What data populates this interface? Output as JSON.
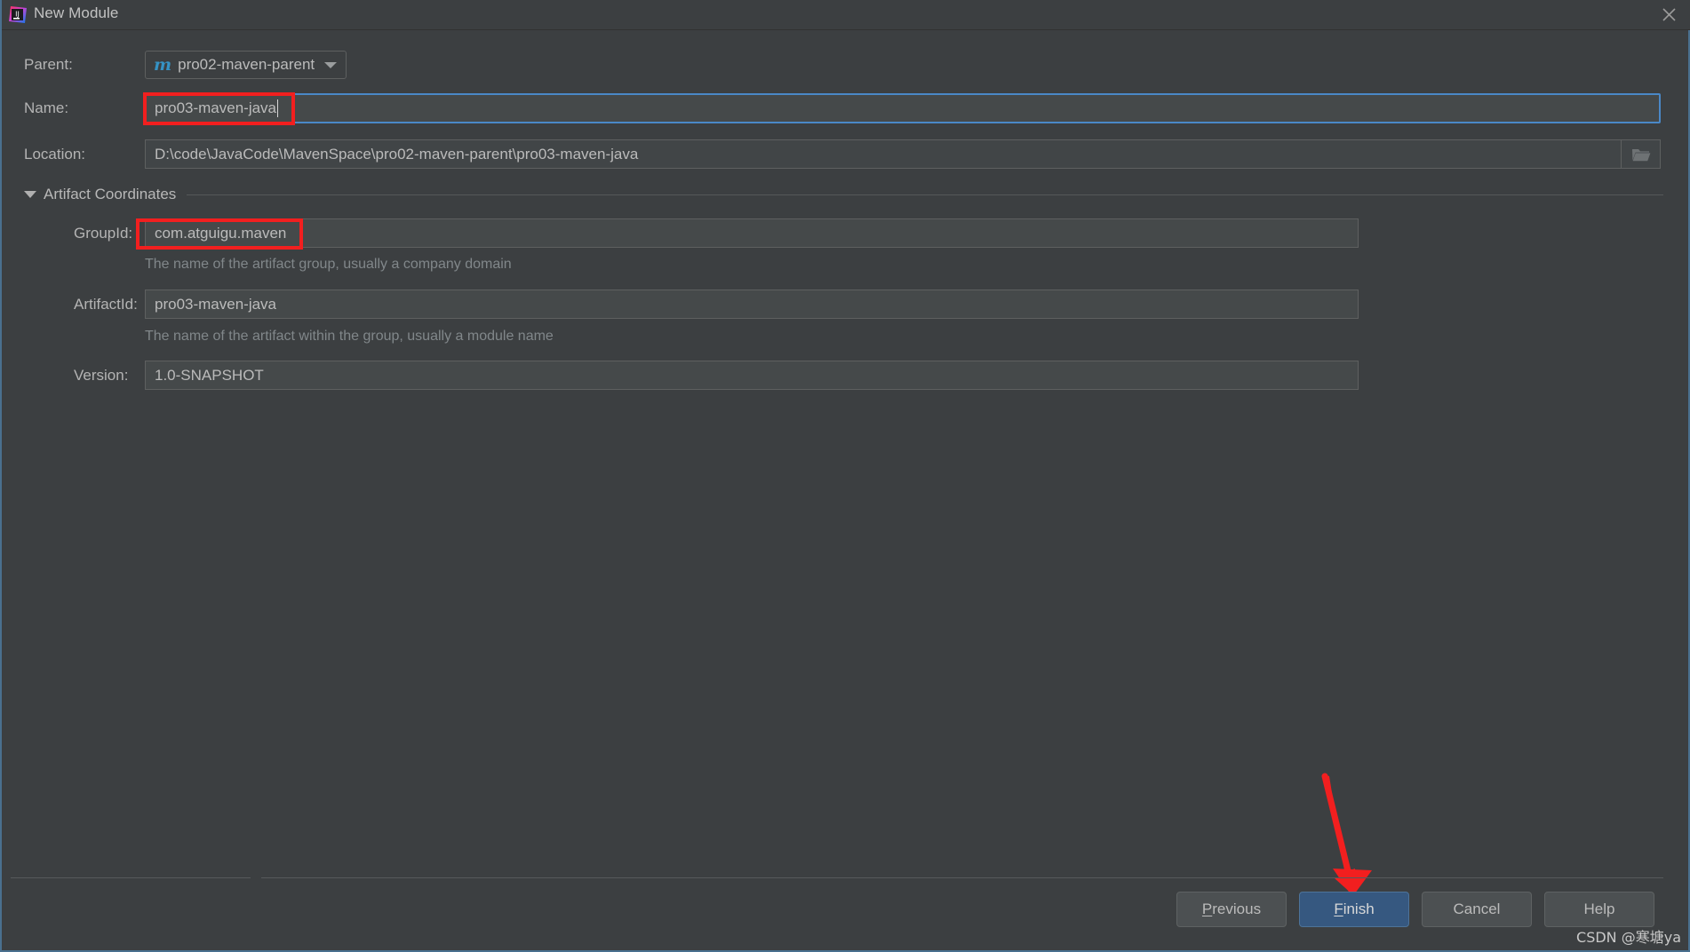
{
  "window": {
    "title": "New Module",
    "app_icon": "intellij-idea-icon",
    "close_icon": "close-icon"
  },
  "form": {
    "parent": {
      "label": "Parent:",
      "value": "pro02-maven-parent",
      "icon": "maven-icon",
      "dropdown_icon": "chevron-down-icon"
    },
    "name": {
      "label": "Name:",
      "value": "pro03-maven-java",
      "focused": true
    },
    "location": {
      "label": "Location:",
      "value": "D:\\code\\JavaCode\\MavenSpace\\pro02-maven-parent\\pro03-maven-java",
      "browse_icon": "folder-icon"
    }
  },
  "artifact_coordinates": {
    "section_label": "Artifact Coordinates",
    "expanded": true,
    "collapse_icon": "triangle-down-icon",
    "group_id": {
      "label": "GroupId:",
      "value": "com.atguigu.maven",
      "hint": "The name of the artifact group, usually a company domain"
    },
    "artifact_id": {
      "label": "ArtifactId:",
      "value": "pro03-maven-java",
      "hint": "The name of the artifact within the group, usually a module name"
    },
    "version": {
      "label": "Version:",
      "value": "1.0-SNAPSHOT"
    }
  },
  "footer": {
    "previous": "Previous",
    "previous_mnemonic": "P",
    "previous_rest": "revious",
    "finish": "Finish",
    "finish_mnemonic": "F",
    "finish_rest": "inish",
    "cancel": "Cancel",
    "help": "Help"
  },
  "annotations": {
    "name_highlight": "red-box-around-name-field",
    "groupid_highlight": "red-box-around-groupid-field",
    "finish_arrow": "red-arrow-pointing-to-finish"
  },
  "watermark": "CSDN @寒塘ya",
  "colors": {
    "dialog_bg": "#3c3f41",
    "field_bg": "#45494a",
    "focus_border": "#4a88c7",
    "primary_button": "#365880",
    "annotation_red": "#f21f1f",
    "maven_icon": "#3592c4"
  }
}
